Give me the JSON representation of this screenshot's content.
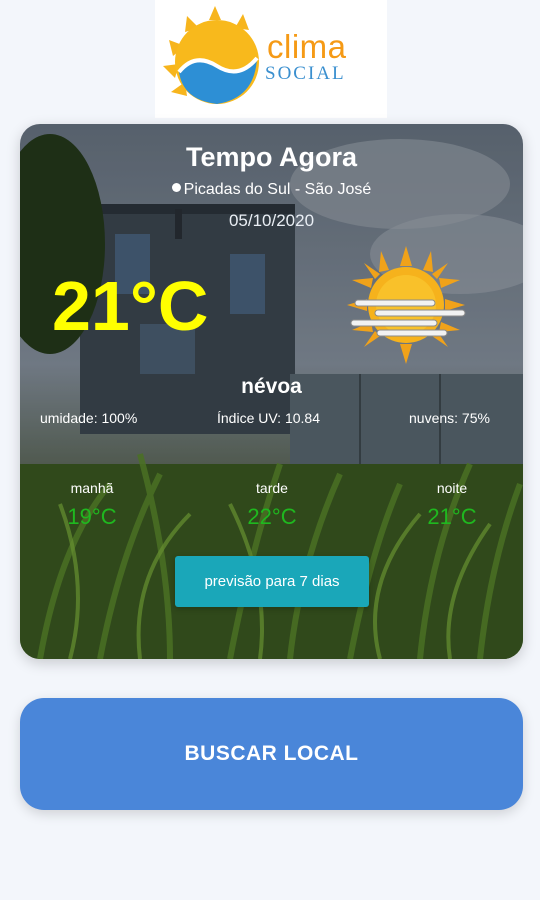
{
  "logo": {
    "line1": "clima",
    "line2": "SOCIAL"
  },
  "weather": {
    "title": "Tempo Agora",
    "location": "Picadas do Sul - São José",
    "date": "05/10/2020",
    "temperature": "21°C",
    "condition": "névoa",
    "condition_icon": "sun-with-fog-icon",
    "humidity": "umidade: 100%",
    "uv_index": "Índice UV: 10.84",
    "clouds": "nuvens: 75%",
    "periods": [
      {
        "label": "manhã",
        "temp": "19°C"
      },
      {
        "label": "tarde",
        "temp": "22°C"
      },
      {
        "label": "noite",
        "temp": "21°C"
      }
    ],
    "forecast_button": "previsão para 7 dias"
  },
  "search_button": "BUSCAR LOCAL",
  "colors": {
    "accent_temperature": "#ffff00",
    "period_temperature": "#1fb81f",
    "forecast_button": "#1aa7b9",
    "search_button": "#4a86d9"
  }
}
